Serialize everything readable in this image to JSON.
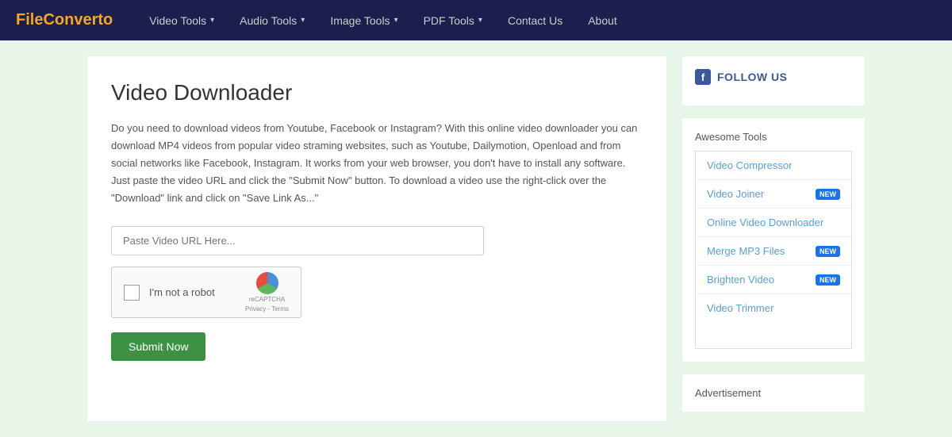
{
  "brand": {
    "text_main": "FileConverto",
    "text_accent": "o",
    "text_before_accent": "FileConvert"
  },
  "navbar": {
    "links": [
      {
        "label": "Video Tools",
        "has_dropdown": true
      },
      {
        "label": "Audio Tools",
        "has_dropdown": true
      },
      {
        "label": "Image Tools",
        "has_dropdown": true
      },
      {
        "label": "PDF Tools",
        "has_dropdown": true
      },
      {
        "label": "Contact Us",
        "has_dropdown": false
      },
      {
        "label": "About",
        "has_dropdown": false
      }
    ]
  },
  "main": {
    "title": "Video Downloader",
    "description": "Do you need to download videos from Youtube, Facebook or Instagram? With this online video downloader you can download MP4 videos from popular video straming websites, such as Youtube, Dailymotion, Openload and from social networks like Facebook, Instagram. It works from your web browser, you don't have to install any software. Just paste the video URL and click the \"Submit Now\" button. To download a video use the right-click over the \"Download\" link and click on \"Save Link As...\"",
    "url_input_placeholder": "Paste Video URL Here...",
    "captcha_label": "I'm not a robot",
    "captcha_brand": "reCAPTCHA",
    "captcha_sub": "Privacy - Terms",
    "submit_label": "Submit Now"
  },
  "sidebar": {
    "follow_us_label": "FOLLOW US",
    "awesome_tools_label": "Awesome Tools",
    "tools": [
      {
        "label": "Video Compressor",
        "badge": null
      },
      {
        "label": "Video Joiner",
        "badge": "NEW"
      },
      {
        "label": "Online Video Downloader",
        "badge": null
      },
      {
        "label": "Merge MP3 Files",
        "badge": "NEW"
      },
      {
        "label": "Brighten Video",
        "badge": "NEW"
      },
      {
        "label": "Video Trimmer",
        "badge": null
      }
    ],
    "advertisement_label": "Advertisement"
  }
}
